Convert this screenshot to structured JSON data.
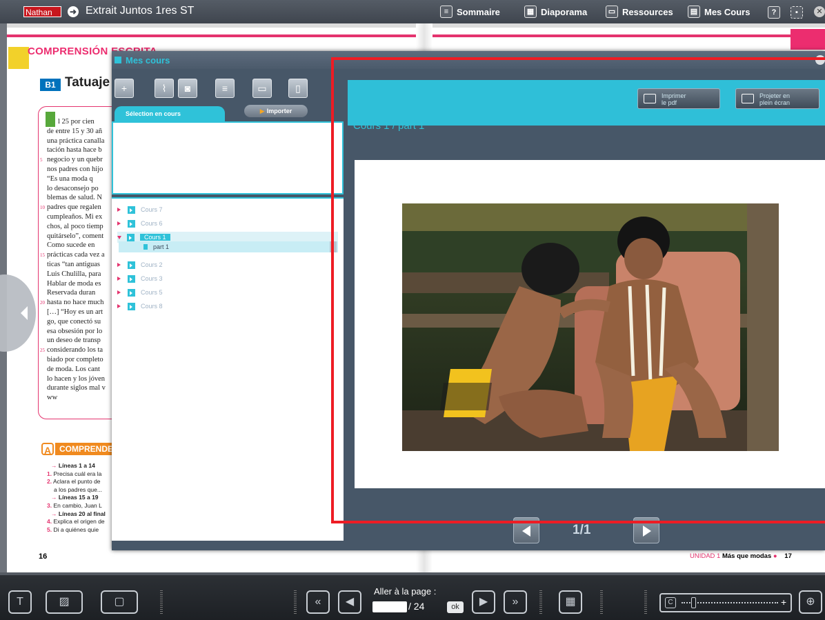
{
  "topbar": {
    "logo": "Nathan",
    "title": "Extrait Juntos 1res ST",
    "menu": [
      {
        "label": "Sommaire",
        "icon": "list-icon"
      },
      {
        "label": "Diaporama",
        "icon": "grid-icon"
      },
      {
        "label": "Ressources",
        "icon": "folder-icon"
      },
      {
        "label": "Mes Cours",
        "icon": "book-icon"
      }
    ],
    "help": "?"
  },
  "book": {
    "section": "COMPRENSIÓN ESCRITA",
    "b1": "B1",
    "article_title": "Tatuaje",
    "article_lines": [
      {
        "n": "",
        "t": "l 25 por cien"
      },
      {
        "n": "",
        "t": "de entre 15 y 30 añ"
      },
      {
        "n": "",
        "t": "una práctica canalla"
      },
      {
        "n": "",
        "t": "tación hasta hace b"
      },
      {
        "n": "5",
        "t": "negocio y un quebr"
      },
      {
        "n": "",
        "t": "nos padres con hijo"
      },
      {
        "n": "",
        "t": "   “Es una moda q"
      },
      {
        "n": "",
        "t": "lo desaconsejo po"
      },
      {
        "n": "",
        "t": "blemas de salud. N"
      },
      {
        "n": "10",
        "t": "padres que regalen"
      },
      {
        "n": "",
        "t": "cumpleaños. Mi ex"
      },
      {
        "n": "",
        "t": "chos, al poco tiemp"
      },
      {
        "n": "",
        "t": "quitárselo”, coment"
      },
      {
        "n": "",
        "t": "   Como sucede en"
      },
      {
        "n": "15",
        "t": "prácticas cada vez a"
      },
      {
        "n": "",
        "t": "ticas “tan antiguas"
      },
      {
        "n": "",
        "t": "Luis Chulilla, para"
      },
      {
        "n": "",
        "t": "Hablar de moda es"
      },
      {
        "n": "",
        "t": "   Reservada duran"
      },
      {
        "n": "20",
        "t": "hasta no hace much"
      },
      {
        "n": "",
        "t": "[…] “Hoy es un art"
      },
      {
        "n": "",
        "t": "go, que conectó su"
      },
      {
        "n": "",
        "t": "esa obsesión por lo"
      },
      {
        "n": "",
        "t": "un deseo de transp"
      },
      {
        "n": "25",
        "t": "considerando los ta"
      },
      {
        "n": "",
        "t": "biado por completo"
      },
      {
        "n": "",
        "t": "de moda. Los cant"
      },
      {
        "n": "",
        "t": "lo hacen y los jóven"
      },
      {
        "n": "",
        "t": "durante siglos mal v"
      },
      {
        "n": "",
        "t": "                   ww"
      }
    ],
    "comprende_letter": "A",
    "comprende": "COMPRENDE",
    "questions": [
      {
        "type": "sub",
        "t": "Líneas 1 a 14"
      },
      {
        "type": "q",
        "n": "1.",
        "t": "Precisa cuál era la"
      },
      {
        "type": "q",
        "n": "2.",
        "t": "Aclara el punto de"
      },
      {
        "type": "q",
        "n": "",
        "t": "a los padres que..."
      },
      {
        "type": "sub",
        "t": "Líneas 15 a 19"
      },
      {
        "type": "q",
        "n": "3.",
        "t": "En cambio, Juan L"
      },
      {
        "type": "sub",
        "t": "Líneas 20 al final"
      },
      {
        "type": "q",
        "n": "4.",
        "t": "Explica el origen de"
      },
      {
        "type": "q",
        "n": "5.",
        "t": "Di a quiénes quie"
      }
    ],
    "page_left": "16",
    "unit_label": "UNIDAD 1",
    "unit_title": "Más que modas",
    "page_right": "17"
  },
  "mes_cours": {
    "title": "Mes cours",
    "tab_selection": "Sélection en cours",
    "importer": "Importer",
    "tree": [
      {
        "label": "Cours 7",
        "open": false
      },
      {
        "label": "Cours 6",
        "open": false
      },
      {
        "label": "Cours 1",
        "open": true,
        "children": [
          "part 1"
        ]
      },
      {
        "label": "Cours 2",
        "open": false
      },
      {
        "label": "Cours 3",
        "open": false
      },
      {
        "label": "Cours 5",
        "open": false
      },
      {
        "label": "Cours 8",
        "open": false
      }
    ],
    "btn_pdf": "Imprimer le pdf",
    "btn_pdf_l1": "Imprimer",
    "btn_pdf_l2": "le pdf",
    "btn_full_l1": "Projeter en",
    "btn_full_l2": "plein écran",
    "breadcrumb": "Cours 1 / part 1",
    "pager": "1/1"
  },
  "bottom": {
    "goto_label": "Aller à la page :",
    "page_value": "",
    "page_total": "/ 24",
    "ok": "ok"
  }
}
